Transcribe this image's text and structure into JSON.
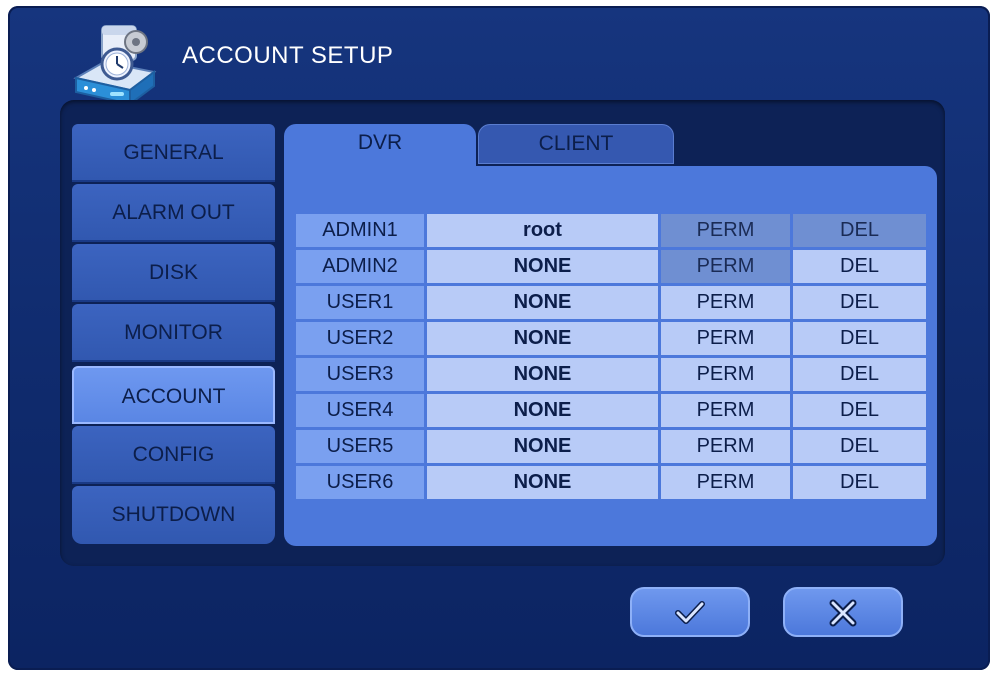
{
  "window": {
    "title": "ACCOUNT SETUP",
    "title_icon": "account-setup-icon"
  },
  "sidebar": {
    "items": [
      {
        "label": "GENERAL"
      },
      {
        "label": "ALARM OUT"
      },
      {
        "label": "DISK"
      },
      {
        "label": "MONITOR"
      },
      {
        "label": "ACCOUNT",
        "active": true
      },
      {
        "label": "CONFIG"
      },
      {
        "label": "SHUTDOWN"
      }
    ]
  },
  "tabs": [
    {
      "label": "DVR",
      "active": true
    },
    {
      "label": "CLIENT",
      "active": false
    }
  ],
  "accounts": [
    {
      "name": "ADMIN1",
      "user": "root",
      "perm": "PERM",
      "del": "DEL",
      "perm_enabled": false,
      "del_enabled": false
    },
    {
      "name": "ADMIN2",
      "user": "NONE",
      "perm": "PERM",
      "del": "DEL",
      "perm_enabled": false,
      "del_enabled": true
    },
    {
      "name": "USER1",
      "user": "NONE",
      "perm": "PERM",
      "del": "DEL",
      "perm_enabled": true,
      "del_enabled": true
    },
    {
      "name": "USER2",
      "user": "NONE",
      "perm": "PERM",
      "del": "DEL",
      "perm_enabled": true,
      "del_enabled": true
    },
    {
      "name": "USER3",
      "user": "NONE",
      "perm": "PERM",
      "del": "DEL",
      "perm_enabled": true,
      "del_enabled": true
    },
    {
      "name": "USER4",
      "user": "NONE",
      "perm": "PERM",
      "del": "DEL",
      "perm_enabled": true,
      "del_enabled": true
    },
    {
      "name": "USER5",
      "user": "NONE",
      "perm": "PERM",
      "del": "DEL",
      "perm_enabled": true,
      "del_enabled": true
    },
    {
      "name": "USER6",
      "user": "NONE",
      "perm": "PERM",
      "del": "DEL",
      "perm_enabled": true,
      "del_enabled": true
    }
  ],
  "buttons": {
    "ok_icon": "check-icon",
    "cancel_icon": "close-icon"
  },
  "colors": {
    "background": "#16357e",
    "panel": "#4c78db",
    "cell": "#b8cbf7",
    "name_cell": "#7aa0f0",
    "disabled_cell": "#6f8fd2"
  }
}
